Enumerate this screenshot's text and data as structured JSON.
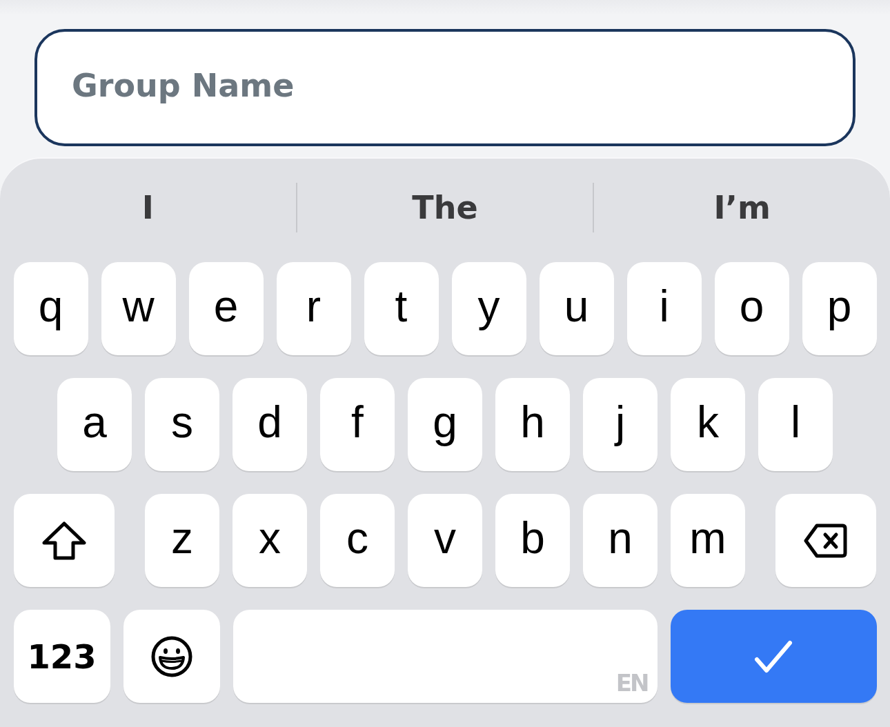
{
  "input": {
    "placeholder": "Group Name",
    "focused": true
  },
  "suggestions": [
    "I",
    "The",
    "I’m"
  ],
  "keyboard": {
    "rows": [
      [
        {
          "kind": "letter",
          "label": "q"
        },
        {
          "kind": "letter",
          "label": "w"
        },
        {
          "kind": "letter",
          "label": "e"
        },
        {
          "kind": "letter",
          "label": "r"
        },
        {
          "kind": "letter",
          "label": "t"
        },
        {
          "kind": "letter",
          "label": "y"
        },
        {
          "kind": "letter",
          "label": "u"
        },
        {
          "kind": "letter",
          "label": "i"
        },
        {
          "kind": "letter",
          "label": "o"
        },
        {
          "kind": "letter",
          "label": "p"
        }
      ],
      [
        {
          "kind": "letter",
          "label": "a"
        },
        {
          "kind": "letter",
          "label": "s"
        },
        {
          "kind": "letter",
          "label": "d"
        },
        {
          "kind": "letter",
          "label": "f"
        },
        {
          "kind": "letter",
          "label": "g"
        },
        {
          "kind": "letter",
          "label": "h"
        },
        {
          "kind": "letter",
          "label": "j"
        },
        {
          "kind": "letter",
          "label": "k"
        },
        {
          "kind": "letter",
          "label": "l"
        }
      ],
      [
        {
          "kind": "shift"
        },
        {
          "kind": "letter",
          "label": "z"
        },
        {
          "kind": "letter",
          "label": "x"
        },
        {
          "kind": "letter",
          "label": "c"
        },
        {
          "kind": "letter",
          "label": "v"
        },
        {
          "kind": "letter",
          "label": "b"
        },
        {
          "kind": "letter",
          "label": "n"
        },
        {
          "kind": "letter",
          "label": "m"
        },
        {
          "kind": "backspace"
        }
      ],
      [
        {
          "kind": "numbers",
          "label": "123"
        },
        {
          "kind": "emoji"
        },
        {
          "kind": "space",
          "label": "EN"
        },
        {
          "kind": "done"
        }
      ]
    ]
  }
}
